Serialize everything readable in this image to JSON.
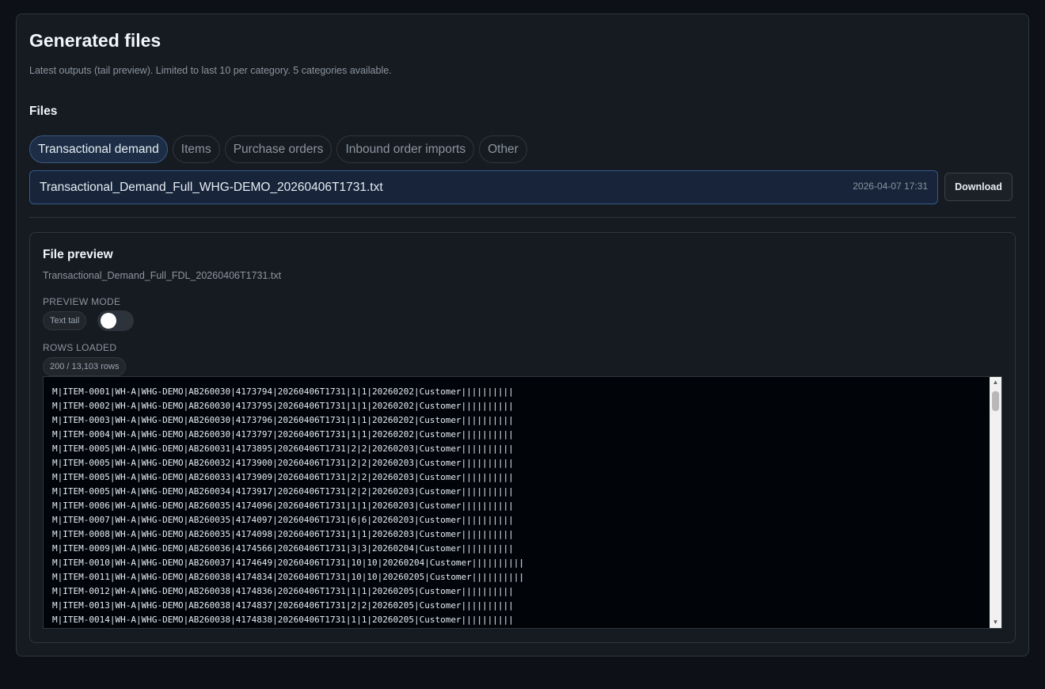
{
  "page": {
    "title": "Generated files",
    "subtitle": "Latest outputs (tail preview). Limited to last 10 per category. 5 categories available."
  },
  "files": {
    "heading": "Files",
    "tabs": [
      {
        "label": "Transactional demand",
        "active": true
      },
      {
        "label": "Items",
        "active": false
      },
      {
        "label": "Purchase orders",
        "active": false
      },
      {
        "label": "Inbound order imports",
        "active": false
      },
      {
        "label": "Other",
        "active": false
      }
    ],
    "selected_file": {
      "name": "Transactional_Demand_Full_WHG-DEMO_20260406T1731.txt",
      "date": "2026-04-07 17:31"
    },
    "download_label": "Download"
  },
  "preview": {
    "title": "File preview",
    "filename": "Transactional_Demand_Full_FDL_20260406T1731.txt",
    "mode_label": "PREVIEW MODE",
    "mode_value": "Text tail",
    "toggle_on": false,
    "rows_label": "ROWS LOADED",
    "rows_value": "200 / 13,103 rows",
    "lines": [
      "M|ITEM-0001|WH-A|WHG-DEMO|AB260030|4173794|20260406T1731|1|1|20260202|Customer||||||||||",
      "M|ITEM-0002|WH-A|WHG-DEMO|AB260030|4173795|20260406T1731|1|1|20260202|Customer||||||||||",
      "M|ITEM-0003|WH-A|WHG-DEMO|AB260030|4173796|20260406T1731|1|1|20260202|Customer||||||||||",
      "M|ITEM-0004|WH-A|WHG-DEMO|AB260030|4173797|20260406T1731|1|1|20260202|Customer||||||||||",
      "M|ITEM-0005|WH-A|WHG-DEMO|AB260031|4173895|20260406T1731|2|2|20260203|Customer||||||||||",
      "M|ITEM-0005|WH-A|WHG-DEMO|AB260032|4173900|20260406T1731|2|2|20260203|Customer||||||||||",
      "M|ITEM-0005|WH-A|WHG-DEMO|AB260033|4173909|20260406T1731|2|2|20260203|Customer||||||||||",
      "M|ITEM-0005|WH-A|WHG-DEMO|AB260034|4173917|20260406T1731|2|2|20260203|Customer||||||||||",
      "M|ITEM-0006|WH-A|WHG-DEMO|AB260035|4174096|20260406T1731|1|1|20260203|Customer||||||||||",
      "M|ITEM-0007|WH-A|WHG-DEMO|AB260035|4174097|20260406T1731|6|6|20260203|Customer||||||||||",
      "M|ITEM-0008|WH-A|WHG-DEMO|AB260035|4174098|20260406T1731|1|1|20260203|Customer||||||||||",
      "M|ITEM-0009|WH-A|WHG-DEMO|AB260036|4174566|20260406T1731|3|3|20260204|Customer||||||||||",
      "M|ITEM-0010|WH-A|WHG-DEMO|AB260037|4174649|20260406T1731|10|10|20260204|Customer||||||||||",
      "M|ITEM-0011|WH-A|WHG-DEMO|AB260038|4174834|20260406T1731|10|10|20260205|Customer||||||||||",
      "M|ITEM-0012|WH-A|WHG-DEMO|AB260038|4174836|20260406T1731|1|1|20260205|Customer||||||||||",
      "M|ITEM-0013|WH-A|WHG-DEMO|AB260038|4174837|20260406T1731|2|2|20260205|Customer||||||||||",
      "M|ITEM-0014|WH-A|WHG-DEMO|AB260038|4174838|20260406T1731|1|1|20260205|Customer||||||||||"
    ]
  }
}
